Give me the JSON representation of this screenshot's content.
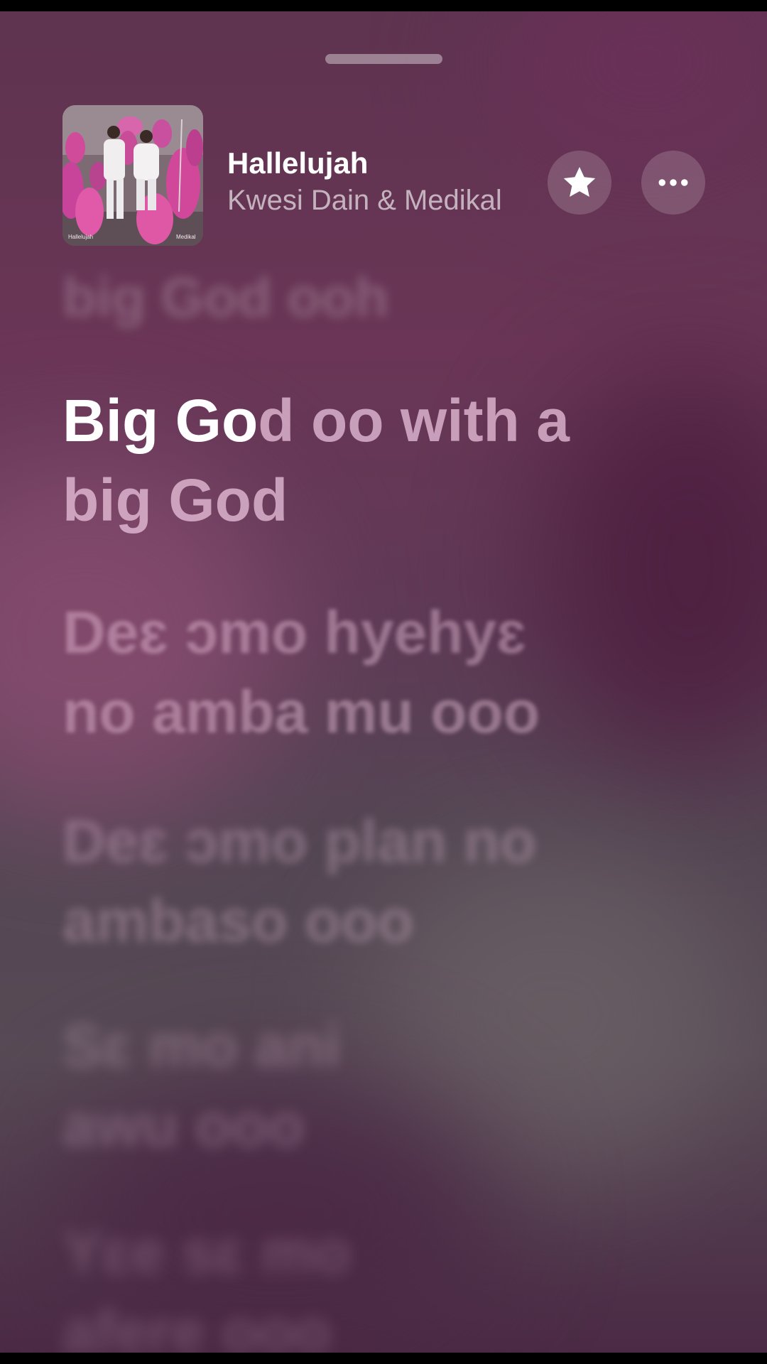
{
  "now_playing": {
    "title": "Hallelujah",
    "artist": "Kwesi Dain & Medikal",
    "artwork_captions": {
      "bottom_left": "Hallelujah",
      "bottom_right": "Medikal"
    }
  },
  "actions": {
    "favorite_icon": "star-icon",
    "more_icon": "ellipsis-icon"
  },
  "lyrics": {
    "previous": "big God ooh",
    "current_sung": "Big Go",
    "current_unsung": "d oo with a\nbig God",
    "upcoming": [
      "Deɛ ɔmo hyehyɛ\nno amba mu ooo",
      "Deɛ ɔmo plan no\nambaso ooo",
      "Sɛ mo ani\nawu ooo",
      "Yɛe sɛ mo\nafere ooo"
    ]
  },
  "colors": {
    "accent_pink": "#e05aa9",
    "lyric_highlight": "#ffffff",
    "background_primary": "#5e3450"
  }
}
